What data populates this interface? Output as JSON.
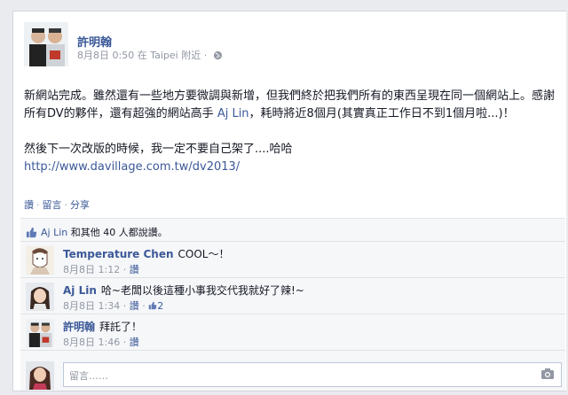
{
  "post": {
    "author": "許明翰",
    "timestamp": "8月8日 0:50",
    "location": "在 Taipei 附近",
    "body_part1": "新網站完成。雖然還有一些地方要微調與新增，但我們終於把我們所有的東西呈現在同一個網站上。感謝所有DV的夥伴，還有超強的網站高手 ",
    "mention": "Aj Lin",
    "body_part2": "，耗時將近8個月(其實真正工作日不到1個月啦...)！",
    "body_line2": "然後下一次改版的時候，我一定不要自己架了....哈哈",
    "link": "http://www.davillage.com.tw/dv2013/"
  },
  "actions": {
    "like": "讚",
    "comment": "留言",
    "share": "分享"
  },
  "likes": {
    "name": "Aj Lin",
    "rest": " 和其他 40 人都說讚。"
  },
  "comments": [
    {
      "name": "Temperature Chen",
      "text": "COOL～！",
      "time": "8月8日 1:12",
      "like": "讚",
      "like_count": ""
    },
    {
      "name": "Aj Lin",
      "text": "哈~老闆以後這種小事我交代我就好了辣!~",
      "time": "8月8日 1:34",
      "like": "讚",
      "like_count": "2"
    },
    {
      "name": "許明翰",
      "text": "拜託了！",
      "time": "8月8日 1:46",
      "like": "讚",
      "like_count": ""
    }
  ],
  "composer": {
    "placeholder": "留言……"
  },
  "colors": {
    "link": "#3b5998",
    "meta": "#9197a3",
    "ufi_bg": "#f6f7f9"
  }
}
